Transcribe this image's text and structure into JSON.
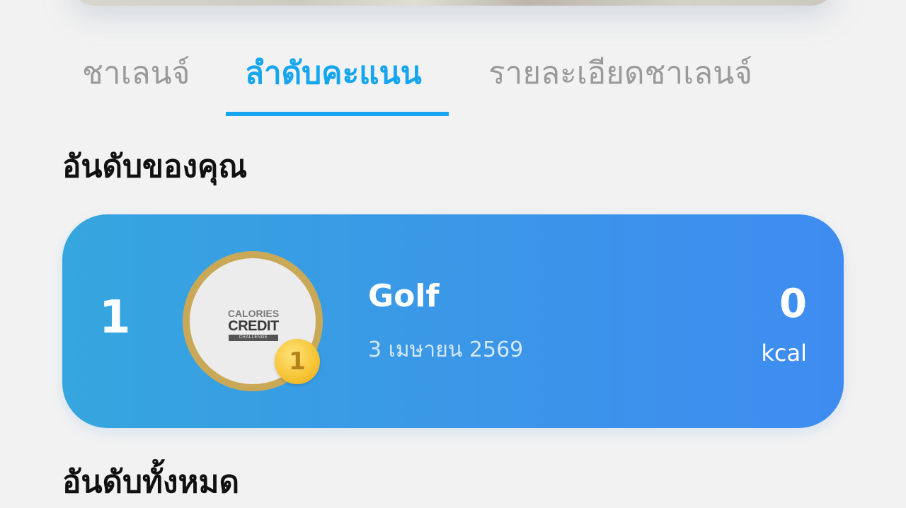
{
  "tabs": [
    {
      "label": "ชาเลนจ์",
      "active": false
    },
    {
      "label": "ลำดับคะแนน",
      "active": true
    },
    {
      "label": "รายละเอียดชาเลนจ์",
      "active": false
    }
  ],
  "your_rank": {
    "title": "อันดับของคุณ",
    "rank": "1",
    "name": "Golf",
    "date": "3 เมษายน 2569",
    "score": "0",
    "unit": "kcal",
    "medal_number": "1",
    "logo": {
      "line1": "CALORIES",
      "line2": "CREDIT",
      "line3": "CHALLENGE"
    }
  },
  "all_rank": {
    "title": "อันดับทั้งหมด"
  },
  "colors": {
    "accent": "#16a6ef",
    "card_gradient_start": "#35a6de",
    "card_gradient_end": "#3f8cf1",
    "medal_gold": "#f7c637",
    "avatar_ring": "#c9a957"
  }
}
